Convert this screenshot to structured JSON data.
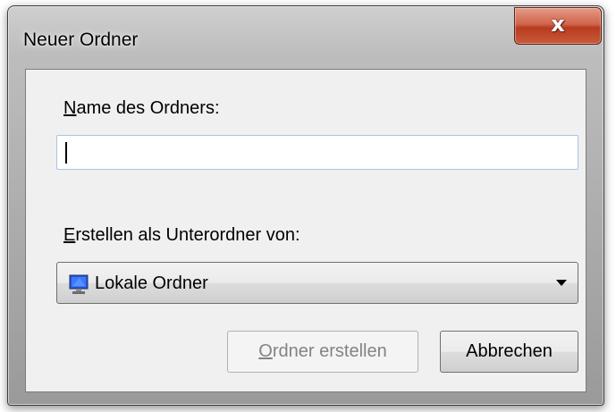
{
  "window": {
    "title": "Neuer Ordner",
    "close_glyph": "x"
  },
  "form": {
    "name_label_accel": "N",
    "name_label_rest": "ame des Ordners:",
    "name_value": "",
    "parent_label_accel": "E",
    "parent_label_rest": "rstellen als Unterordner von:",
    "parent_selected": "Lokale Ordner",
    "parent_icon": "local-folders-monitor-icon"
  },
  "buttons": {
    "create_accel": "O",
    "create_rest": "rdner erstellen",
    "create_enabled": false,
    "cancel_label": "Abbrechen"
  },
  "colors": {
    "close_button": "#c95a3a",
    "input_border": "#a9c4e2",
    "disabled_text": "#838383"
  }
}
